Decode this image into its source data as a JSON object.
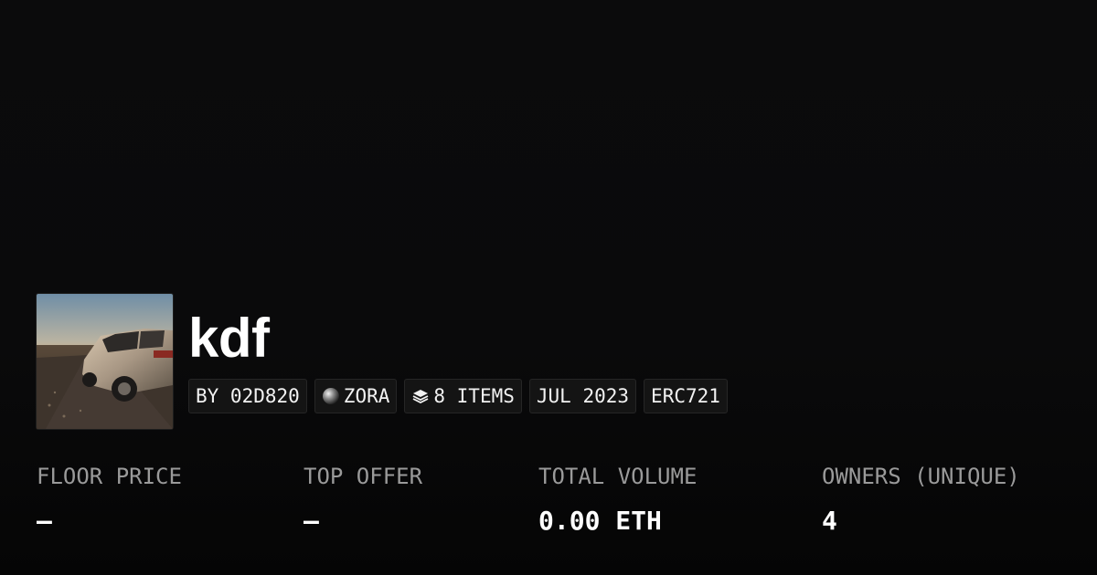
{
  "collection": {
    "name": "kdf",
    "thumbnail_icon": "collection-image-car"
  },
  "tags": {
    "creator": "BY 02D820",
    "network": "ZORA",
    "network_icon": "zora-orb-icon",
    "items": "8 ITEMS",
    "items_icon": "layers-icon",
    "date": "JUL 2023",
    "standard": "ERC721"
  },
  "stats": [
    {
      "label": "FLOOR PRICE",
      "value": "—"
    },
    {
      "label": "TOP OFFER",
      "value": "—"
    },
    {
      "label": "TOTAL VOLUME",
      "value": "0.00 ETH"
    },
    {
      "label": "OWNERS (UNIQUE)",
      "value": "4"
    }
  ],
  "colors": {
    "background": "#0b0b0c",
    "tag_background": "#141414",
    "label": "#9a9a9a",
    "value": "#ffffff"
  }
}
